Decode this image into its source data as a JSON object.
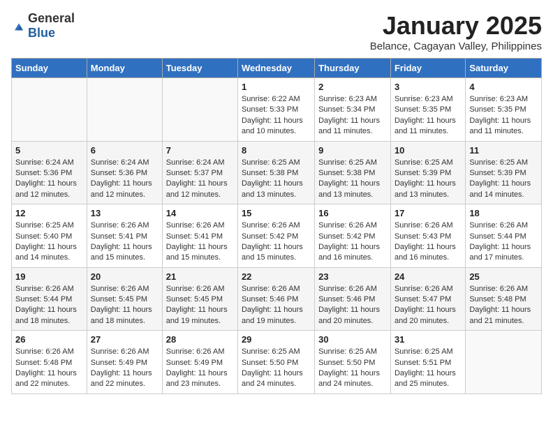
{
  "header": {
    "logo_general": "General",
    "logo_blue": "Blue",
    "month_title": "January 2025",
    "subtitle": "Belance, Cagayan Valley, Philippines"
  },
  "days_of_week": [
    "Sunday",
    "Monday",
    "Tuesday",
    "Wednesday",
    "Thursday",
    "Friday",
    "Saturday"
  ],
  "weeks": [
    [
      {
        "day": "",
        "content": ""
      },
      {
        "day": "",
        "content": ""
      },
      {
        "day": "",
        "content": ""
      },
      {
        "day": "1",
        "content": "Sunrise: 6:22 AM\nSunset: 5:33 PM\nDaylight: 11 hours and 10 minutes."
      },
      {
        "day": "2",
        "content": "Sunrise: 6:23 AM\nSunset: 5:34 PM\nDaylight: 11 hours and 11 minutes."
      },
      {
        "day": "3",
        "content": "Sunrise: 6:23 AM\nSunset: 5:35 PM\nDaylight: 11 hours and 11 minutes."
      },
      {
        "day": "4",
        "content": "Sunrise: 6:23 AM\nSunset: 5:35 PM\nDaylight: 11 hours and 11 minutes."
      }
    ],
    [
      {
        "day": "5",
        "content": "Sunrise: 6:24 AM\nSunset: 5:36 PM\nDaylight: 11 hours and 12 minutes."
      },
      {
        "day": "6",
        "content": "Sunrise: 6:24 AM\nSunset: 5:36 PM\nDaylight: 11 hours and 12 minutes."
      },
      {
        "day": "7",
        "content": "Sunrise: 6:24 AM\nSunset: 5:37 PM\nDaylight: 11 hours and 12 minutes."
      },
      {
        "day": "8",
        "content": "Sunrise: 6:25 AM\nSunset: 5:38 PM\nDaylight: 11 hours and 13 minutes."
      },
      {
        "day": "9",
        "content": "Sunrise: 6:25 AM\nSunset: 5:38 PM\nDaylight: 11 hours and 13 minutes."
      },
      {
        "day": "10",
        "content": "Sunrise: 6:25 AM\nSunset: 5:39 PM\nDaylight: 11 hours and 13 minutes."
      },
      {
        "day": "11",
        "content": "Sunrise: 6:25 AM\nSunset: 5:39 PM\nDaylight: 11 hours and 14 minutes."
      }
    ],
    [
      {
        "day": "12",
        "content": "Sunrise: 6:25 AM\nSunset: 5:40 PM\nDaylight: 11 hours and 14 minutes."
      },
      {
        "day": "13",
        "content": "Sunrise: 6:26 AM\nSunset: 5:41 PM\nDaylight: 11 hours and 15 minutes."
      },
      {
        "day": "14",
        "content": "Sunrise: 6:26 AM\nSunset: 5:41 PM\nDaylight: 11 hours and 15 minutes."
      },
      {
        "day": "15",
        "content": "Sunrise: 6:26 AM\nSunset: 5:42 PM\nDaylight: 11 hours and 15 minutes."
      },
      {
        "day": "16",
        "content": "Sunrise: 6:26 AM\nSunset: 5:42 PM\nDaylight: 11 hours and 16 minutes."
      },
      {
        "day": "17",
        "content": "Sunrise: 6:26 AM\nSunset: 5:43 PM\nDaylight: 11 hours and 16 minutes."
      },
      {
        "day": "18",
        "content": "Sunrise: 6:26 AM\nSunset: 5:44 PM\nDaylight: 11 hours and 17 minutes."
      }
    ],
    [
      {
        "day": "19",
        "content": "Sunrise: 6:26 AM\nSunset: 5:44 PM\nDaylight: 11 hours and 18 minutes."
      },
      {
        "day": "20",
        "content": "Sunrise: 6:26 AM\nSunset: 5:45 PM\nDaylight: 11 hours and 18 minutes."
      },
      {
        "day": "21",
        "content": "Sunrise: 6:26 AM\nSunset: 5:45 PM\nDaylight: 11 hours and 19 minutes."
      },
      {
        "day": "22",
        "content": "Sunrise: 6:26 AM\nSunset: 5:46 PM\nDaylight: 11 hours and 19 minutes."
      },
      {
        "day": "23",
        "content": "Sunrise: 6:26 AM\nSunset: 5:46 PM\nDaylight: 11 hours and 20 minutes."
      },
      {
        "day": "24",
        "content": "Sunrise: 6:26 AM\nSunset: 5:47 PM\nDaylight: 11 hours and 20 minutes."
      },
      {
        "day": "25",
        "content": "Sunrise: 6:26 AM\nSunset: 5:48 PM\nDaylight: 11 hours and 21 minutes."
      }
    ],
    [
      {
        "day": "26",
        "content": "Sunrise: 6:26 AM\nSunset: 5:48 PM\nDaylight: 11 hours and 22 minutes."
      },
      {
        "day": "27",
        "content": "Sunrise: 6:26 AM\nSunset: 5:49 PM\nDaylight: 11 hours and 22 minutes."
      },
      {
        "day": "28",
        "content": "Sunrise: 6:26 AM\nSunset: 5:49 PM\nDaylight: 11 hours and 23 minutes."
      },
      {
        "day": "29",
        "content": "Sunrise: 6:25 AM\nSunset: 5:50 PM\nDaylight: 11 hours and 24 minutes."
      },
      {
        "day": "30",
        "content": "Sunrise: 6:25 AM\nSunset: 5:50 PM\nDaylight: 11 hours and 24 minutes."
      },
      {
        "day": "31",
        "content": "Sunrise: 6:25 AM\nSunset: 5:51 PM\nDaylight: 11 hours and 25 minutes."
      },
      {
        "day": "",
        "content": ""
      }
    ]
  ]
}
